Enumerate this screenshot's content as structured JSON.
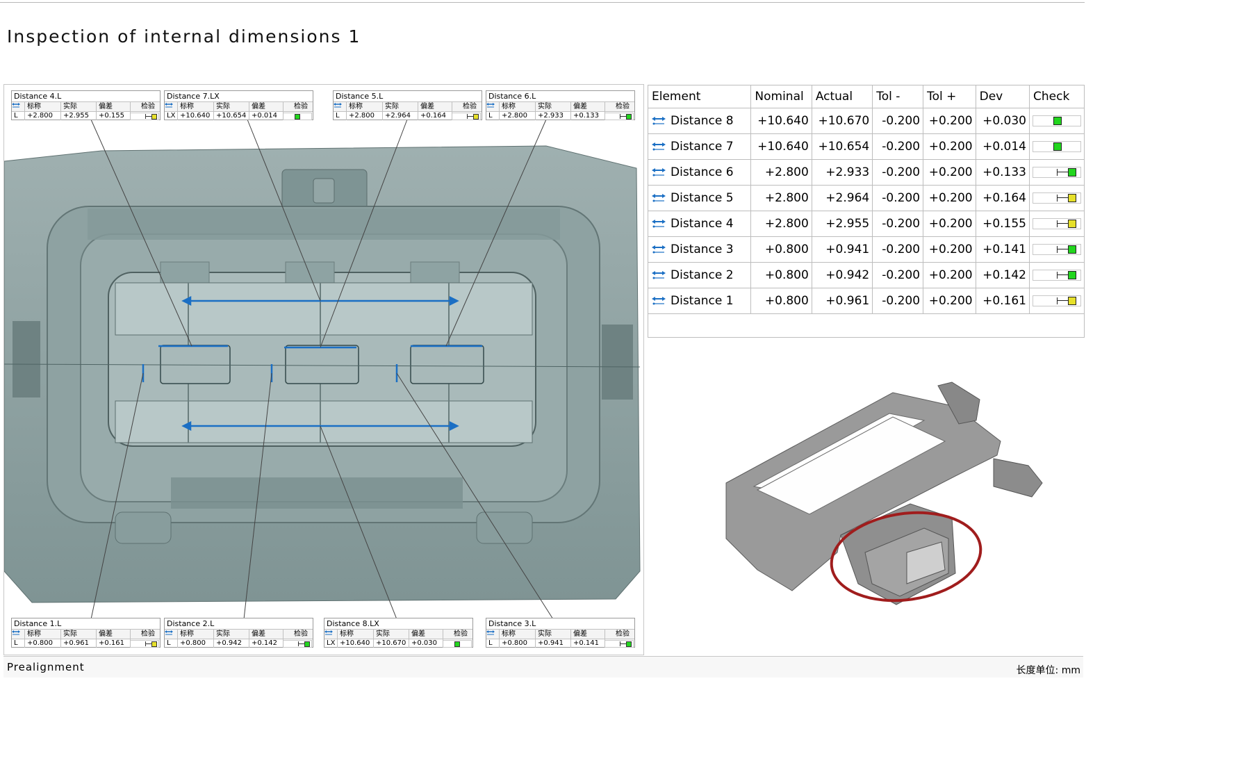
{
  "page": {
    "title": "Inspection of internal dimensions 1",
    "status_left": "Prealignment",
    "status_right": "长度单位: mm"
  },
  "callout_headers": {
    "nominal": "标称",
    "actual": "实际",
    "deviation": "偏差",
    "check": "检验"
  },
  "callouts": [
    {
      "title": "Distance 4.L",
      "axis": "L",
      "nominal": "+2.800",
      "actual": "+2.955",
      "dev": "+0.155",
      "check": "yellow"
    },
    {
      "title": "Distance 7.LX",
      "axis": "LX",
      "nominal": "+10.640",
      "actual": "+10.654",
      "dev": "+0.014",
      "check": "green-center"
    },
    {
      "title": "Distance 5.L",
      "axis": "L",
      "nominal": "+2.800",
      "actual": "+2.964",
      "dev": "+0.164",
      "check": "yellow"
    },
    {
      "title": "Distance 6.L",
      "axis": "L",
      "nominal": "+2.800",
      "actual": "+2.933",
      "dev": "+0.133",
      "check": "green"
    },
    {
      "title": "Distance 1.L",
      "axis": "L",
      "nominal": "+0.800",
      "actual": "+0.961",
      "dev": "+0.161",
      "check": "yellow"
    },
    {
      "title": "Distance 2.L",
      "axis": "L",
      "nominal": "+0.800",
      "actual": "+0.942",
      "dev": "+0.142",
      "check": "green"
    },
    {
      "title": "Distance 8.LX",
      "axis": "LX",
      "nominal": "+10.640",
      "actual": "+10.670",
      "dev": "+0.030",
      "check": "green-center"
    },
    {
      "title": "Distance 3.L",
      "axis": "L",
      "nominal": "+0.800",
      "actual": "+0.941",
      "dev": "+0.141",
      "check": "green"
    }
  ],
  "table": {
    "headers": [
      "Element",
      "Nominal",
      "Actual",
      "Tol -",
      "Tol +",
      "Dev",
      "Check"
    ],
    "rows": [
      {
        "element": "Distance 8",
        "nominal": "+10.640",
        "actual": "+10.670",
        "tol_minus": "-0.200",
        "tol_plus": "+0.200",
        "dev": "+0.030",
        "check": "green-center"
      },
      {
        "element": "Distance 7",
        "nominal": "+10.640",
        "actual": "+10.654",
        "tol_minus": "-0.200",
        "tol_plus": "+0.200",
        "dev": "+0.014",
        "check": "green-center"
      },
      {
        "element": "Distance 6",
        "nominal": "+2.800",
        "actual": "+2.933",
        "tol_minus": "-0.200",
        "tol_plus": "+0.200",
        "dev": "+0.133",
        "check": "green"
      },
      {
        "element": "Distance 5",
        "nominal": "+2.800",
        "actual": "+2.964",
        "tol_minus": "-0.200",
        "tol_plus": "+0.200",
        "dev": "+0.164",
        "check": "yellow"
      },
      {
        "element": "Distance 4",
        "nominal": "+2.800",
        "actual": "+2.955",
        "tol_minus": "-0.200",
        "tol_plus": "+0.200",
        "dev": "+0.155",
        "check": "yellow"
      },
      {
        "element": "Distance 3",
        "nominal": "+0.800",
        "actual": "+0.941",
        "tol_minus": "-0.200",
        "tol_plus": "+0.200",
        "dev": "+0.141",
        "check": "green"
      },
      {
        "element": "Distance 2",
        "nominal": "+0.800",
        "actual": "+0.942",
        "tol_minus": "-0.200",
        "tol_plus": "+0.200",
        "dev": "+0.142",
        "check": "green"
      },
      {
        "element": "Distance 1",
        "nominal": "+0.800",
        "actual": "+0.961",
        "tol_minus": "-0.200",
        "tol_plus": "+0.200",
        "dev": "+0.161",
        "check": "yellow"
      }
    ]
  },
  "colors": {
    "pass_green": "#22d61e",
    "warn_yellow": "#e6e02a",
    "measure_blue": "#1b6fc4",
    "scan_gray": "#8fa2a2",
    "highlight_red": "#a01d1d"
  }
}
